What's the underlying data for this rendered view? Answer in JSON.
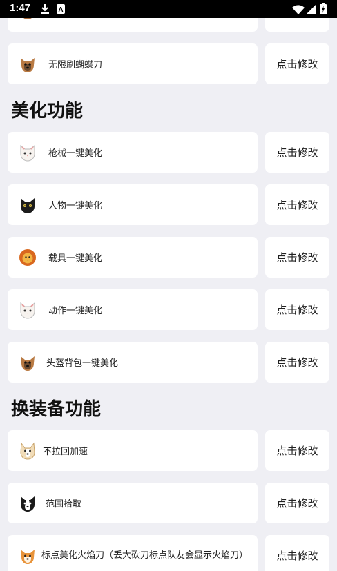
{
  "status_bar": {
    "time": "1:47",
    "left_icons": [
      "download-icon",
      "a-badge-icon"
    ],
    "right_icons": [
      "wifi-icon",
      "signal-icon",
      "battery-icon"
    ]
  },
  "button_label": "点击修改",
  "rows_top": [
    {
      "label": "",
      "avatar": "dog-brown-icon"
    },
    {
      "label": "无限刷蝴蝶刀",
      "avatar": "dog-yorkie-icon"
    }
  ],
  "section_beautify": {
    "title": "美化功能",
    "items": [
      {
        "label": "枪械一键美化",
        "avatar": "cat-white-icon"
      },
      {
        "label": "人物一键美化",
        "avatar": "cat-black-icon"
      },
      {
        "label": "载具一键美化",
        "avatar": "lion-icon"
      },
      {
        "label": "动作一键美化",
        "avatar": "cat-white-icon"
      },
      {
        "label": "头盔背包一键美化",
        "avatar": "dog-yorkie-icon"
      }
    ]
  },
  "section_equip": {
    "title": "换装备功能",
    "items": [
      {
        "label": "不拉回加速",
        "avatar": "dog-corgi-icon"
      },
      {
        "label": "范围拾取",
        "avatar": "dog-border-collie-icon"
      },
      {
        "label": "标点美化火焰刀（丢大砍刀标点队友会显示火焰刀）",
        "avatar": "dog-shiba-icon"
      }
    ]
  },
  "colors": {
    "background": "#efeff4",
    "card": "#ffffff",
    "status_bar": "#000000"
  }
}
